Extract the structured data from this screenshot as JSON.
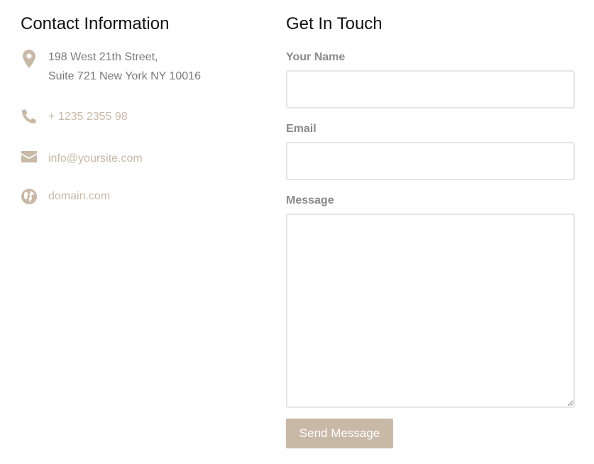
{
  "contact": {
    "title": "Contact Information",
    "address_line1": "198 West 21th Street,",
    "address_line2": "Suite 721 New York NY 10016",
    "phone": "+ 1235 2355 98",
    "email": "info@yoursite.com",
    "website": "domain.com"
  },
  "form": {
    "title": "Get In Touch",
    "name_label": "Your Name",
    "name_value": "",
    "email_label": "Email",
    "email_value": "",
    "message_label": "Message",
    "message_value": "",
    "submit_label": "Send Message"
  },
  "colors": {
    "accent": "#c8b9a7",
    "text_muted": "#7a7a7a",
    "label": "#8a8a8a",
    "input_border": "#e6e6e6"
  },
  "icons": [
    "map-marker-icon",
    "phone-icon",
    "envelope-icon",
    "globe-icon"
  ]
}
